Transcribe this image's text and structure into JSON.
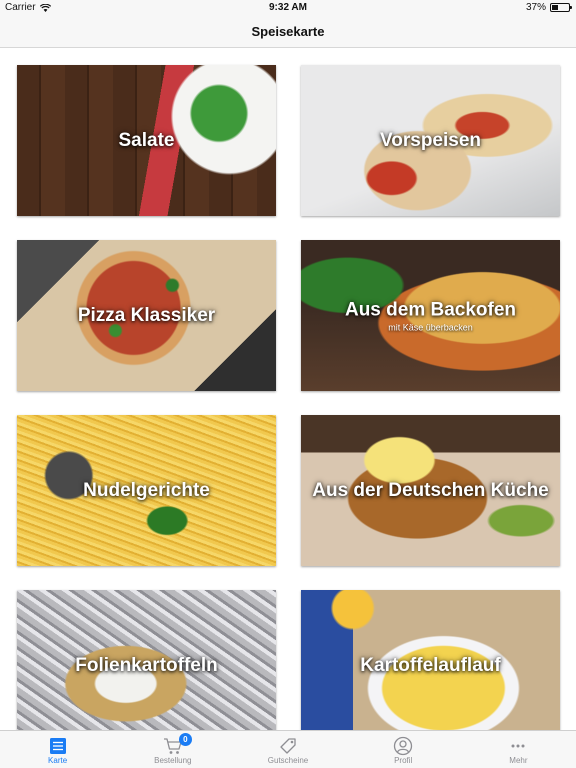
{
  "status_bar": {
    "carrier": "Carrier",
    "time": "9:32 AM",
    "battery_percent_label": "37%",
    "battery_level": 0.37
  },
  "nav": {
    "title": "Speisekarte"
  },
  "tiles": [
    {
      "title": "Salate",
      "subtitle": ""
    },
    {
      "title": "Vorspeisen",
      "subtitle": ""
    },
    {
      "title": "Pizza Klassiker",
      "subtitle": ""
    },
    {
      "title": "Aus dem Backofen",
      "subtitle": "mit Käse überbacken"
    },
    {
      "title": "Nudelgerichte",
      "subtitle": ""
    },
    {
      "title": "Aus der Deutschen Küche",
      "subtitle": ""
    },
    {
      "title": "Folienkartoffeln",
      "subtitle": ""
    },
    {
      "title": "Kartoffelauflauf",
      "subtitle": ""
    }
  ],
  "tab_bar": {
    "tabs": [
      {
        "label": "Karte",
        "icon": "list-icon",
        "active": true
      },
      {
        "label": "Bestellung",
        "icon": "cart-icon",
        "active": false,
        "badge": "0"
      },
      {
        "label": "Gutscheine",
        "icon": "tag-icon",
        "active": false
      },
      {
        "label": "Profil",
        "icon": "profile-icon",
        "active": false
      },
      {
        "label": "Mehr",
        "icon": "more-icon",
        "active": false
      }
    ]
  },
  "colors": {
    "accent": "#1a7cf4",
    "inactive": "#8e8e93",
    "bar_background": "#f7f7f7"
  }
}
